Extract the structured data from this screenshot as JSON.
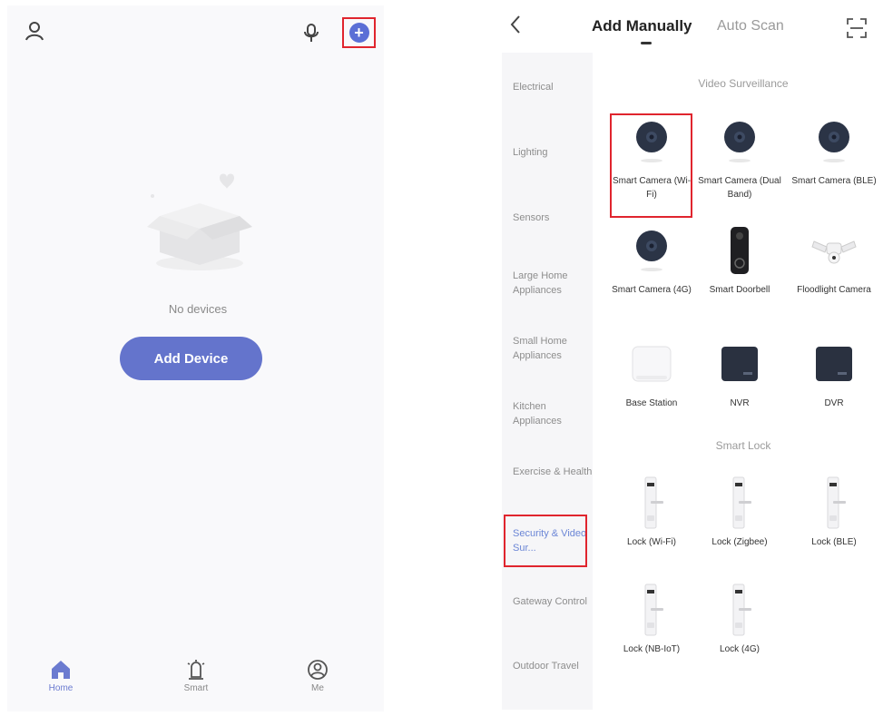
{
  "left_screen": {
    "empty_text": "No devices",
    "add_device_label": "Add Device",
    "bottom_nav": [
      {
        "label": "Home",
        "icon": "home-icon"
      },
      {
        "label": "Smart",
        "icon": "smart-icon"
      },
      {
        "label": "Me",
        "icon": "profile-icon"
      }
    ],
    "accent_color": "#6474cc"
  },
  "right_screen": {
    "tabs": {
      "manual": "Add Manually",
      "auto": "Auto Scan"
    },
    "categories": [
      "Electrical",
      "Lighting",
      "Sensors",
      "Large Home Appliances",
      "Small Home Appliances",
      "Kitchen Appliances",
      "Exercise & Health",
      "Security & Video Sur...",
      "Gateway Control",
      "Outdoor Travel"
    ],
    "active_category": "Security & Video Sur...",
    "sections": [
      {
        "title": "Video Surveillance",
        "devices": [
          {
            "name": "Smart Camera (Wi-Fi)",
            "icon": "camera-icon"
          },
          {
            "name": "Smart Camera (Dual Band)",
            "icon": "camera-icon"
          },
          {
            "name": "Smart Camera (BLE)",
            "icon": "camera-icon"
          },
          {
            "name": "Smart Camera (4G)",
            "icon": "camera-icon"
          },
          {
            "name": "Smart Doorbell",
            "icon": "doorbell-icon"
          },
          {
            "name": "Floodlight Camera",
            "icon": "floodlight-icon"
          },
          {
            "name": "Base Station",
            "icon": "base-station-icon"
          },
          {
            "name": "NVR",
            "icon": "nvr-icon"
          },
          {
            "name": "DVR",
            "icon": "dvr-icon"
          }
        ]
      },
      {
        "title": "Smart Lock",
        "devices": [
          {
            "name": "Lock (Wi-Fi)",
            "icon": "lock-icon"
          },
          {
            "name": "Lock (Zigbee)",
            "icon": "lock-icon"
          },
          {
            "name": "Lock (BLE)",
            "icon": "lock-icon"
          },
          {
            "name": "Lock (NB-IoT)",
            "icon": "lock-icon"
          },
          {
            "name": "Lock (4G)",
            "icon": "lock-icon"
          }
        ]
      }
    ],
    "highlight_color": "#e0252e"
  }
}
